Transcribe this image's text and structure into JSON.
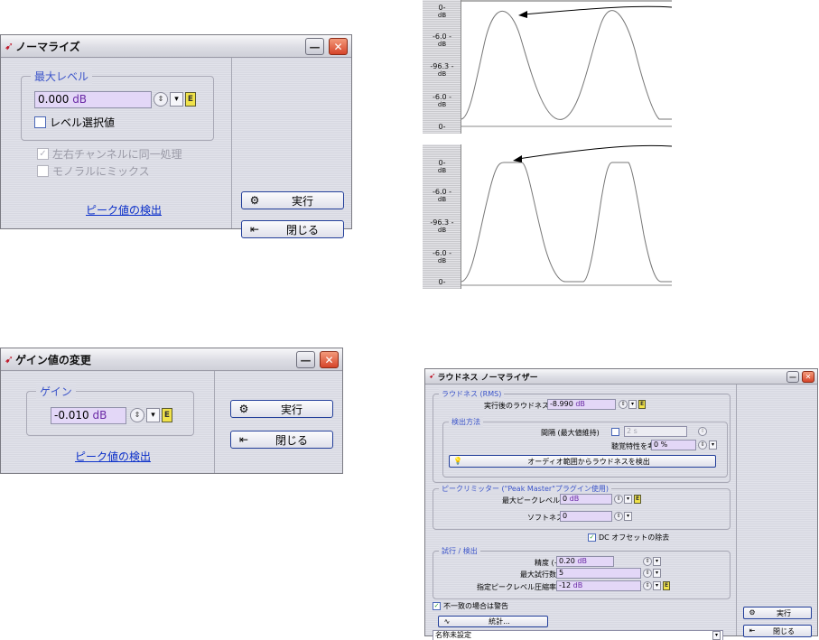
{
  "normalize": {
    "title": "ノーマライズ",
    "group_label": "最大レベル",
    "level_value": "0.000",
    "level_unit": "dB",
    "checkbox_label": "レベル選択値",
    "option_same": "左右チャンネルに同一処理",
    "option_mono": "モノラルにミックス",
    "peak_link": "ピーク値の検出",
    "execute": "実行",
    "close": "閉じる"
  },
  "gain": {
    "title": "ゲイン値の変更",
    "group_label": "ゲイン",
    "gain_value": "-0.010",
    "gain_unit": "dB",
    "peak_link": "ピーク値の検出",
    "execute": "実行",
    "close": "閉じる"
  },
  "waveform_top": {
    "ticks": [
      {
        "value": "0-",
        "unit": "dB"
      },
      {
        "value": "-6.0 -",
        "unit": "dB"
      },
      {
        "value": "-96.3 -",
        "unit": "dB"
      },
      {
        "value": "-6.0 -",
        "unit": "dB"
      },
      {
        "value": "0-",
        "unit": ""
      }
    ]
  },
  "waveform_bottom": {
    "ticks": [
      {
        "value": "0-",
        "unit": "dB"
      },
      {
        "value": "-6.0 -",
        "unit": "dB"
      },
      {
        "value": "-96.3 -",
        "unit": "dB"
      },
      {
        "value": "-6.0 -",
        "unit": "dB"
      },
      {
        "value": "0-",
        "unit": ""
      }
    ]
  },
  "loudness": {
    "title": "ラウドネス ノーマライザー",
    "group_rms": "ラウドネス (RMS)",
    "target_label": "実行後のラウドネス",
    "target_value": "-8.990",
    "target_unit": "dB",
    "detect_group": "検出方法",
    "interval_label": "間隔 (最大値維持)",
    "interval_value": "2 s",
    "hearing_label": "聴覚特性を考慮",
    "hearing_value": "0 %",
    "detect_button": "オーディオ範囲からラウドネスを検出",
    "limiter_group": "ピークリミッター (\"Peak Master\"プラグイン使用)",
    "max_peak_label": "最大ピークレベル",
    "max_peak_value": "0",
    "max_peak_unit": "dB",
    "softness_label": "ソフトネス",
    "softness_value": "0",
    "dc_label": "DC オフセットの除去",
    "trial_group": "試行 / 検出",
    "precision_label": "精度 (+/-)",
    "precision_value": "0.20",
    "precision_unit": "dB",
    "max_trials_label": "最大試行数",
    "max_trials_value": "5",
    "compress_label": "指定ピークレベル圧縮率",
    "compress_value": "-12",
    "compress_unit": "dB",
    "mismatch_label": "不一致の場合は警告",
    "stats_button": "統計...",
    "preset_value": "名称未設定",
    "execute": "実行",
    "close": "閉じる"
  }
}
